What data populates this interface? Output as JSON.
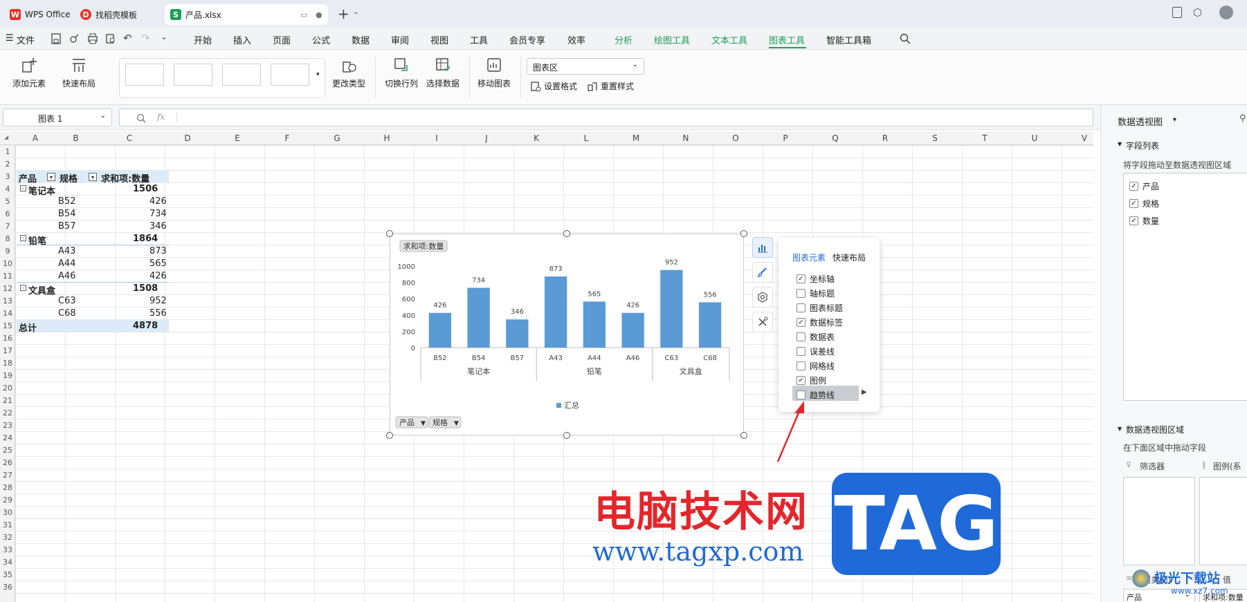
{
  "tabs": {
    "wps": "WPS Office",
    "template": "找稻壳模板",
    "file": "产品.xlsx"
  },
  "menu": {
    "file": "文件",
    "items": [
      "开始",
      "插入",
      "页面",
      "公式",
      "数据",
      "审阅",
      "视图",
      "工具",
      "会员专享",
      "效率"
    ],
    "green": [
      "分析",
      "绘图工具",
      "文本工具"
    ],
    "active": "图表工具",
    "smart": "智能工具箱"
  },
  "toolbar": {
    "add_element": "添加元素",
    "quick_layout": "快速布局",
    "change_type": "更改类型",
    "switch_rowcol": "切换行列",
    "select_data": "选择数据",
    "move_chart": "移动图表",
    "chart_area": "图表区",
    "set_format": "设置格式",
    "reset_style": "重置样式"
  },
  "formula": {
    "name_box": "图表 1",
    "fx": "fx"
  },
  "columns": [
    "A",
    "B",
    "C",
    "D",
    "E",
    "F",
    "G",
    "H",
    "I",
    "J",
    "K",
    "L",
    "M",
    "N",
    "O",
    "P",
    "Q",
    "R",
    "S",
    "T",
    "U",
    "V"
  ],
  "rows": [
    "1",
    "2",
    "3",
    "4",
    "5",
    "6",
    "7",
    "8",
    "9",
    "10",
    "11",
    "12",
    "13",
    "14",
    "15",
    "16",
    "17",
    "18",
    "19",
    "20",
    "21",
    "22",
    "23",
    "24",
    "25",
    "26",
    "27",
    "28",
    "29",
    "30",
    "31",
    "32",
    "33",
    "34",
    "35",
    "36"
  ],
  "pivot": {
    "h_product": "产品",
    "h_spec": "规格",
    "h_sum": "求和项:数量",
    "g1": "笔记本",
    "g1_total": "1506",
    "r1": [
      "B52",
      "426"
    ],
    "r2": [
      "B54",
      "734"
    ],
    "r3": [
      "B57",
      "346"
    ],
    "g2": "铅笔",
    "g2_total": "1864",
    "r4": [
      "A43",
      "873"
    ],
    "r5": [
      "A44",
      "565"
    ],
    "r6": [
      "A46",
      "426"
    ],
    "g3": "文具盒",
    "g3_total": "1508",
    "r7": [
      "C63",
      "952"
    ],
    "r8": [
      "C68",
      "556"
    ],
    "total": "总计",
    "grand": "4878"
  },
  "chart_data": {
    "type": "bar",
    "title": "求和项:数量",
    "categories": [
      "B52",
      "B54",
      "B57",
      "A43",
      "A44",
      "A46",
      "C63",
      "C68"
    ],
    "groups": [
      {
        "name": "笔记本",
        "count": 3
      },
      {
        "name": "铅笔",
        "count": 3
      },
      {
        "name": "文具盒",
        "count": 2
      }
    ],
    "series": [
      {
        "name": "汇总",
        "values": [
          426,
          734,
          346,
          873,
          565,
          426,
          952,
          556
        ]
      }
    ],
    "yticks": [
      "0",
      "200",
      "400",
      "600",
      "800",
      "1000"
    ],
    "ylim": [
      0,
      1000
    ],
    "bar_color": "#5b9bd5",
    "legend": "bottom",
    "field_buttons": [
      "产品",
      "规格"
    ]
  },
  "popup": {
    "tab1": "图表元素",
    "tab2": "快速布局",
    "items": [
      {
        "label": "坐标轴",
        "checked": true
      },
      {
        "label": "轴标题",
        "checked": false
      },
      {
        "label": "图表标题",
        "checked": false
      },
      {
        "label": "数据标签",
        "checked": true
      },
      {
        "label": "数据表",
        "checked": false
      },
      {
        "label": "误差线",
        "checked": false
      },
      {
        "label": "网格线",
        "checked": false
      },
      {
        "label": "图例",
        "checked": true
      },
      {
        "label": "趋势线",
        "checked": false
      }
    ]
  },
  "panel": {
    "title": "数据透视图",
    "field_list": "字段列表",
    "field_hint": "将字段拖动至数据透视图区域",
    "fields": [
      "产品",
      "规格",
      "数量"
    ],
    "area_title": "数据透视图区域",
    "area_hint": "在下面区域中拖动字段",
    "filter": "筛选器",
    "legend_series": "图例(系",
    "axis_cat": "轴(类别)",
    "value": "值",
    "axis_value": "产品",
    "sum_value": "求和项:数量"
  },
  "watermark": {
    "cn": "电脑技术网",
    "url": "www.tagxp.com",
    "tag": "TAG",
    "site": "极光下载站",
    "site_url": "www.xz7.com"
  },
  "colors": {
    "green": "#1e9e5a",
    "accent": "#2a6bd1",
    "wps_red": "#e8332a",
    "tag_blue": "#1f6ad8",
    "wm_red": "#e3262b"
  }
}
